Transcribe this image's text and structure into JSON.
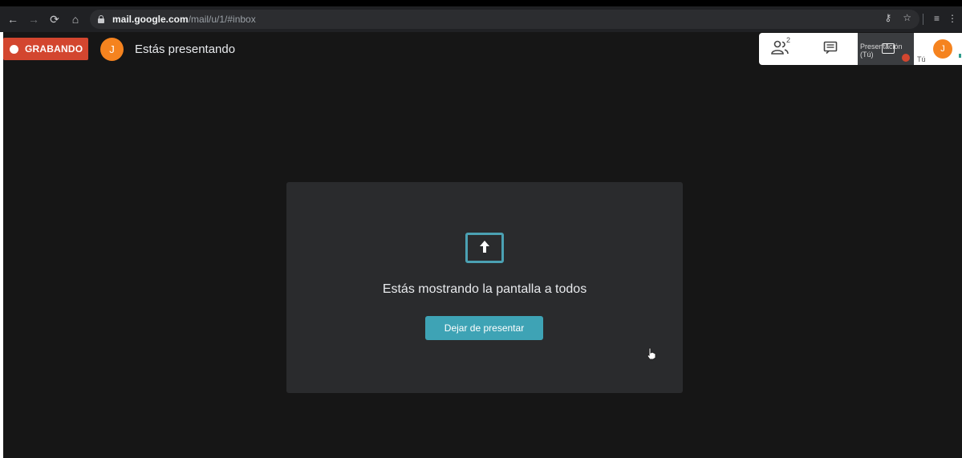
{
  "browser": {
    "url_host": "mail.google.com",
    "url_path": "/mail/u/1/#inbox"
  },
  "meet": {
    "recording_label": "GRABANDO",
    "presenter_initial": "J",
    "presenting_status": "Estás presentando",
    "participants_count": "2",
    "presentation_tile_label": "Presentación (Tú)",
    "self_label": "Tú",
    "self_initial": "J",
    "share_message": "Estás mostrando la pantalla a todos",
    "stop_button_label": "Dejar de presentar"
  },
  "colors": {
    "recording": "#d3462f",
    "accent": "#3ea3b5",
    "avatar": "#f5831f"
  }
}
